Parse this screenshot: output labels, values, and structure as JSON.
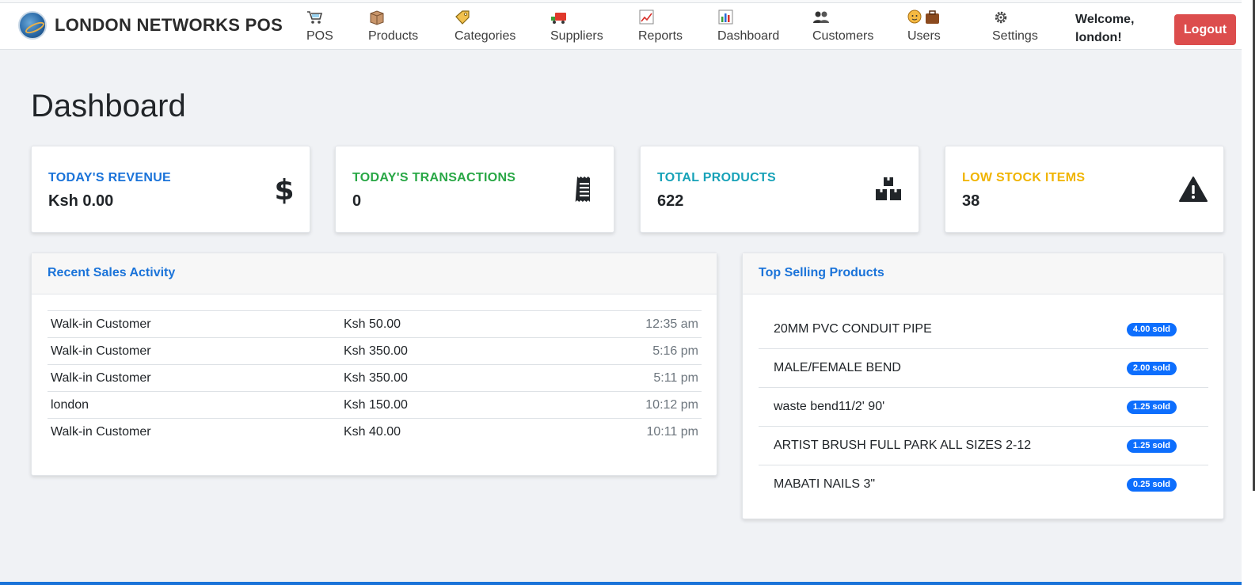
{
  "brand": {
    "name": "LONDON NETWORKS POS"
  },
  "nav": {
    "items": [
      {
        "label": "POS",
        "icon": "cart-icon"
      },
      {
        "label": "Products",
        "icon": "box-icon"
      },
      {
        "label": "Categories",
        "icon": "tag-icon"
      },
      {
        "label": "Suppliers",
        "icon": "truck-icon"
      },
      {
        "label": "Reports",
        "icon": "chart-line-icon"
      },
      {
        "label": "Dashboard",
        "icon": "bar-chart-icon"
      },
      {
        "label": "Customers",
        "icon": "people-icon"
      },
      {
        "label": "Users",
        "icon": "user-briefcase-icon"
      },
      {
        "label": "Settings",
        "icon": "gear-icon"
      }
    ],
    "welcome_line1": "Welcome,",
    "welcome_line2": "london!",
    "logout_label": "Logout"
  },
  "page": {
    "title": "Dashboard"
  },
  "stats": [
    {
      "label": "TODAY'S REVENUE",
      "value": "Ksh 0.00",
      "color": "#1a73d9",
      "icon": "dollar-icon"
    },
    {
      "label": "TODAY'S TRANSACTIONS",
      "value": "0",
      "color": "#28a745",
      "icon": "receipt-icon"
    },
    {
      "label": "TOTAL PRODUCTS",
      "value": "622",
      "color": "#17a2b8",
      "icon": "boxes-icon"
    },
    {
      "label": "LOW STOCK ITEMS",
      "value": "38",
      "color": "#f0b400",
      "icon": "warning-icon"
    }
  ],
  "recent_sales": {
    "title": "Recent Sales Activity",
    "rows": [
      {
        "customer": "Walk-in Customer",
        "amount": "Ksh 50.00",
        "time": "12:35 am"
      },
      {
        "customer": "Walk-in Customer",
        "amount": "Ksh 350.00",
        "time": "5:16 pm"
      },
      {
        "customer": "Walk-in Customer",
        "amount": "Ksh 350.00",
        "time": "5:11 pm"
      },
      {
        "customer": "london",
        "amount": "Ksh 150.00",
        "time": "10:12 pm"
      },
      {
        "customer": "Walk-in Customer",
        "amount": "Ksh 40.00",
        "time": "10:11 pm"
      }
    ]
  },
  "top_selling": {
    "title": "Top Selling Products",
    "items": [
      {
        "name": "20MM PVC CONDUIT PIPE",
        "sold": "4.00 sold"
      },
      {
        "name": "MALE/FEMALE BEND",
        "sold": "2.00 sold"
      },
      {
        "name": "waste bend11/2' 90'",
        "sold": "1.25 sold"
      },
      {
        "name": "ARTIST BRUSH FULL PARK ALL SIZES 2-12",
        "sold": "1.25 sold"
      },
      {
        "name": "MABATI NAILS 3\"",
        "sold": "0.25 sold"
      }
    ]
  }
}
